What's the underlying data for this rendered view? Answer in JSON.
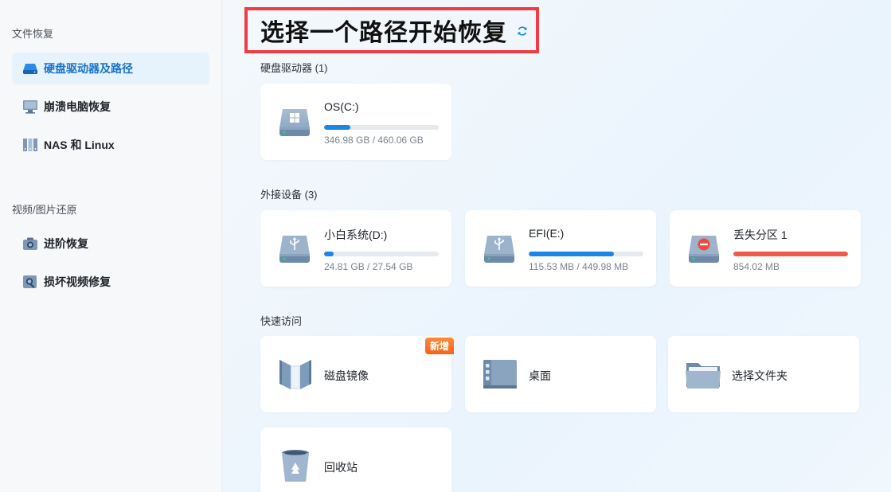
{
  "sidebar": {
    "section_file_recovery": "文件恢复",
    "items_file": [
      {
        "label": "硬盘驱动器及路径",
        "icon": "drive-icon",
        "active": true
      },
      {
        "label": "崩溃电脑恢复",
        "icon": "monitor-icon",
        "active": false
      },
      {
        "label": "NAS 和 Linux",
        "icon": "nas-icon",
        "active": false
      }
    ],
    "section_media": "视频/图片还原",
    "items_media": [
      {
        "label": "进阶恢复",
        "icon": "camera-icon",
        "active": false
      },
      {
        "label": "损坏视频修复",
        "icon": "video-repair-icon",
        "active": false
      }
    ]
  },
  "main": {
    "title": "选择一个路径开始恢复",
    "refresh_icon": "refresh-icon",
    "hard_drives": {
      "label": "硬盘驱动器 (1)",
      "drives": [
        {
          "name": "OS(C:)",
          "size": "346.98 GB / 460.06 GB",
          "usage": 0.23,
          "icon": "windows-drive-icon"
        }
      ]
    },
    "external": {
      "label": "外接设备 (3)",
      "drives": [
        {
          "name": "小白系统(D:)",
          "size": "24.81 GB / 27.54 GB",
          "usage": 0.08,
          "icon": "usb-drive-icon"
        },
        {
          "name": "EFI(E:)",
          "size": "115.53 MB / 449.98 MB",
          "usage": 0.74,
          "icon": "usb-drive-icon"
        },
        {
          "name": "丢失分区 1",
          "size": "854.02 MB",
          "usage": 1.0,
          "icon": "lost-partition-icon"
        }
      ]
    },
    "quick_access": {
      "label": "快速访问",
      "items": [
        {
          "name": "磁盘镜像",
          "badge": "新增",
          "icon": "disk-image-icon"
        },
        {
          "name": "桌面",
          "icon": "desktop-icon"
        },
        {
          "name": "选择文件夹",
          "icon": "folder-icon"
        },
        {
          "name": "回收站",
          "icon": "recycle-bin-icon"
        }
      ]
    }
  },
  "colors": {
    "accent": "#1a86e8",
    "active_bg": "#e6f2fc",
    "highlight_border": "#ef3b41",
    "lost_bar": "#ef5a4a",
    "badge": "#f2661b"
  }
}
